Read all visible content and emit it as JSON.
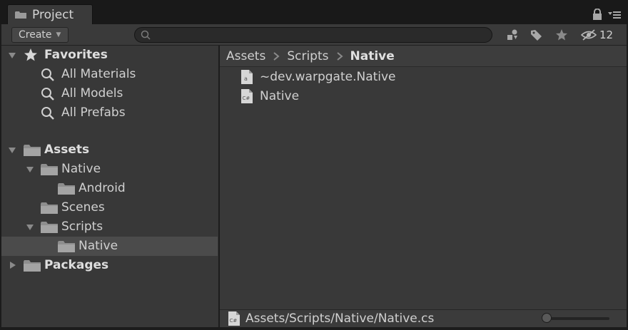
{
  "tab": {
    "title": "Project"
  },
  "toolbar": {
    "create_label": "Create",
    "search": {
      "value": "",
      "placeholder": ""
    },
    "hidden_count": "12"
  },
  "tree": {
    "favorites": {
      "label": "Favorites",
      "items": [
        {
          "label": "All Materials"
        },
        {
          "label": "All Models"
        },
        {
          "label": "All Prefabs"
        }
      ]
    },
    "assets": {
      "label": "Assets",
      "native": {
        "label": "Native",
        "android": "Android"
      },
      "scenes": "Scenes",
      "scripts": {
        "label": "Scripts",
        "native": "Native"
      }
    },
    "packages": "Packages"
  },
  "breadcrumb": {
    "items": [
      "Assets",
      "Scripts",
      "Native"
    ]
  },
  "files": [
    {
      "label": "~dev.warpgate.Native",
      "icon": "asmdef-icon"
    },
    {
      "label": "Native",
      "icon": "csharp-script-icon"
    }
  ],
  "status": {
    "path": "Assets/Scripts/Native/Native.cs"
  },
  "colors": {
    "panel": "#383838",
    "selection": "#4b4b4b",
    "text": "#d0d0d0",
    "background": "#1c1c1c"
  }
}
